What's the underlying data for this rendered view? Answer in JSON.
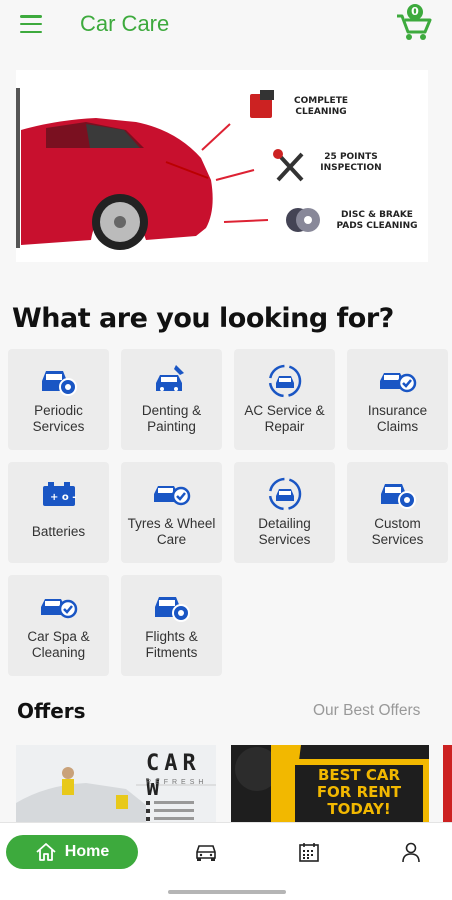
{
  "app": {
    "title": "Car Care",
    "cart_count": "0"
  },
  "banner": {
    "features": [
      "COMPLETE CLEANING",
      "25 POINTS INSPECTION",
      "DISC & BRAKE PADS CLEANING"
    ]
  },
  "section": {
    "title": "What are you looking for?"
  },
  "services": [
    {
      "label": "Periodic Services",
      "icon": "car-gear-icon"
    },
    {
      "label": "Denting & Painting",
      "icon": "car-paint-icon"
    },
    {
      "label": "AC Service & Repair",
      "icon": "car-ac-icon"
    },
    {
      "label": "Insurance Claims",
      "icon": "car-check-icon"
    },
    {
      "label": "Batteries",
      "icon": "battery-icon"
    },
    {
      "label": "Tyres & Wheel Care",
      "icon": "car-check-icon"
    },
    {
      "label": "Detailing Services",
      "icon": "car-ac-icon"
    },
    {
      "label": "Custom Services",
      "icon": "car-gear-icon"
    },
    {
      "label": "Car Spa & Cleaning",
      "icon": "car-check-icon"
    },
    {
      "label": "Flights & Fitments",
      "icon": "car-gear-icon"
    }
  ],
  "offers": {
    "title": "Offers",
    "link": "Our Best Offers",
    "cards": [
      {
        "headline": "CAR W",
        "sub": "REFRESH"
      },
      {
        "headline": "BEST CAR FOR RENT TODAY!"
      }
    ]
  },
  "nav": {
    "home": "Home"
  },
  "colors": {
    "accent": "#3daa3d",
    "icon_blue": "#1a56c4",
    "banner_red": "#c8102e"
  }
}
